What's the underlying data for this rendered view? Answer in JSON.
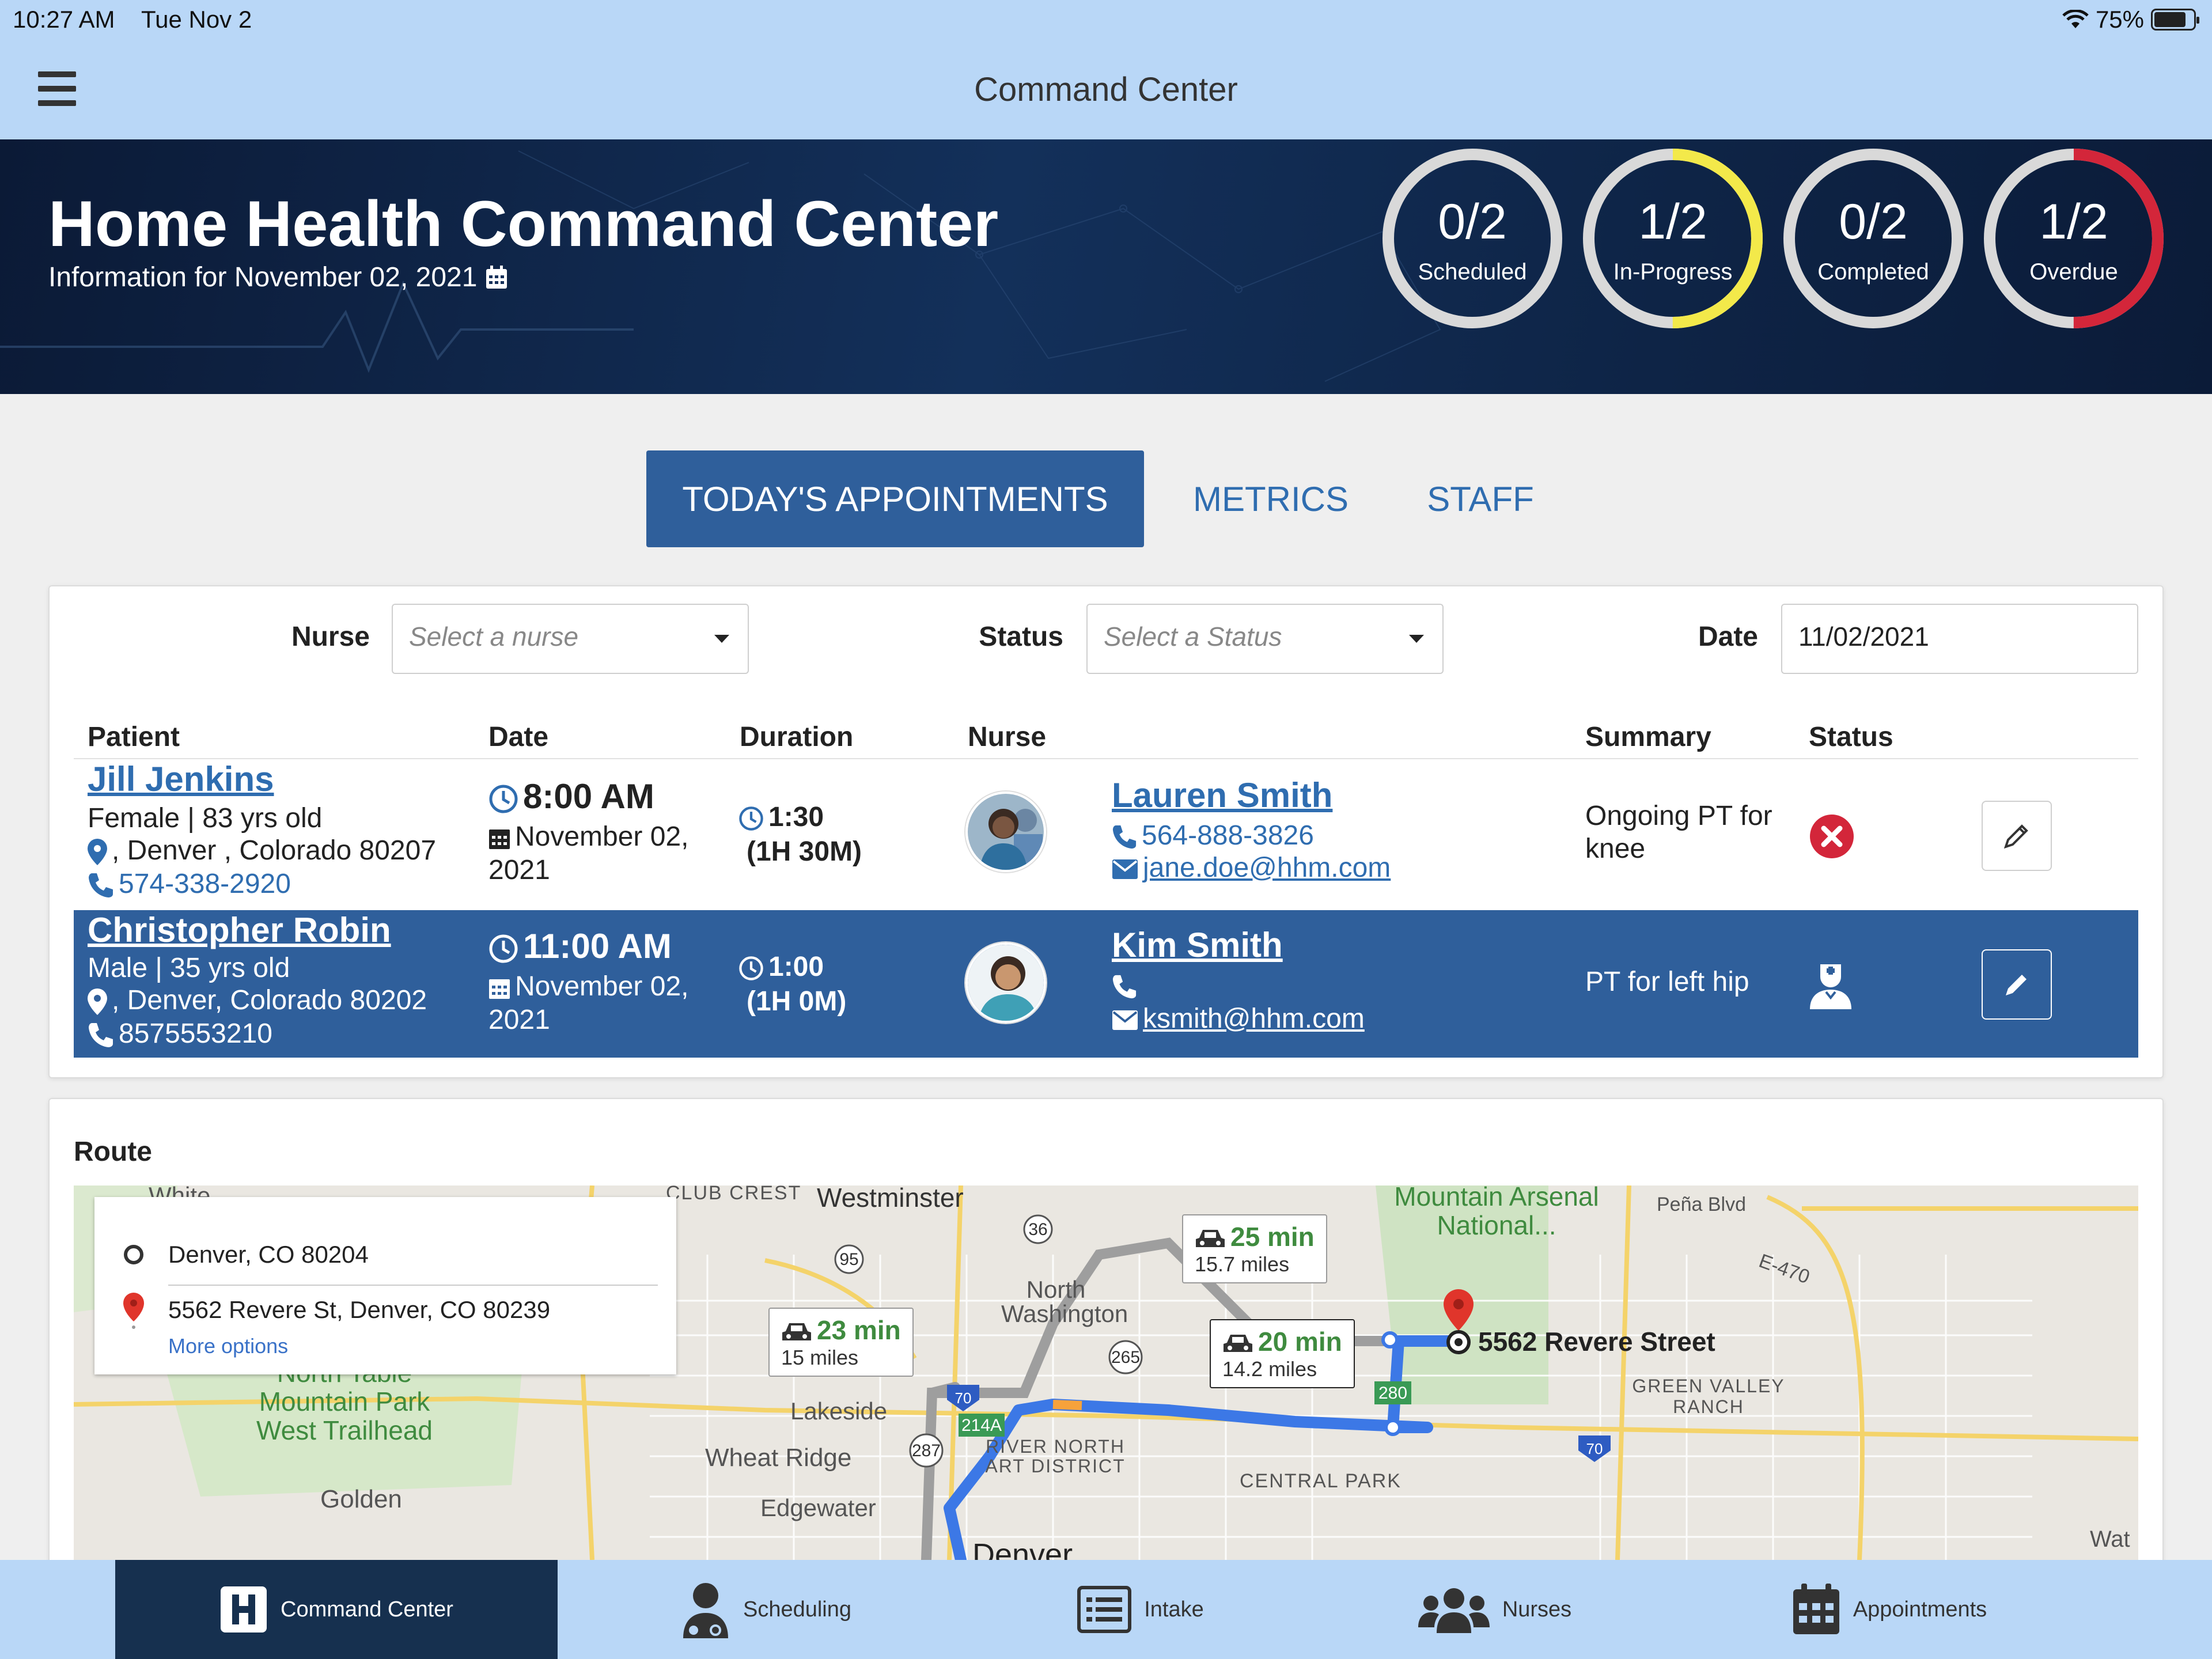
{
  "status_bar": {
    "time": "10:27 AM",
    "date": "Tue Nov 2",
    "battery": "75%"
  },
  "nav": {
    "title": "Command Center"
  },
  "hero": {
    "title": "Home Health Command Center",
    "subtitle": "Information for November 02, 2021",
    "stats": [
      {
        "value": "1/2",
        "label": "Overdue",
        "progress": 0.5,
        "color": "#d3263a"
      },
      {
        "value": "0/2",
        "label": "Completed",
        "progress": 0,
        "color": "#cccccc"
      },
      {
        "value": "1/2",
        "label": "In-Progress",
        "progress": 0.5,
        "color": "#f3e94a"
      },
      {
        "value": "0/2",
        "label": "Scheduled",
        "progress": 0,
        "color": "#cccccc"
      }
    ]
  },
  "tabs": [
    {
      "label": "TODAY'S APPOINTMENTS",
      "active": true
    },
    {
      "label": "METRICS",
      "active": false
    },
    {
      "label": "STAFF",
      "active": false
    }
  ],
  "filters": {
    "nurse_label": "Nurse",
    "nurse_placeholder": "Select a nurse",
    "status_label": "Status",
    "status_placeholder": "Select a Status",
    "date_label": "Date",
    "date_value": "11/02/2021"
  },
  "table": {
    "headers": [
      "Patient",
      "Date",
      "Duration",
      "Nurse",
      "Summary",
      "Status"
    ],
    "rows": [
      {
        "patient_name": "Jill Jenkins",
        "demographics": "Female | 83 yrs old",
        "address": ", Denver , Colorado 80207",
        "phone": "574-338-2920",
        "time": "8:00 AM",
        "date_line1": "November 02,",
        "date_line2": "2021",
        "duration": "1:30",
        "duration_long": "(1H 30M)",
        "nurse_name": "Lauren Smith",
        "nurse_phone": "564-888-3826",
        "nurse_email": "jane.doe@hhm.com",
        "summary": "Ongoing PT for knee",
        "status_icon": "overdue-x-icon"
      },
      {
        "patient_name": "Christopher Robin",
        "demographics": "Male | 35 yrs old",
        "address": ", Denver, Colorado 80202",
        "phone": "8575553210",
        "time": "11:00 AM",
        "date_line1": "November 02,",
        "date_line2": "2021",
        "duration": "1:00",
        "duration_long": "(1H 0M)",
        "nurse_name": "Kim Smith",
        "nurse_phone": "",
        "nurse_email": "ksmith@hhm.com",
        "summary": "PT for left hip",
        "status_icon": "nurse-in-progress-icon"
      }
    ]
  },
  "route": {
    "title": "Route",
    "origin": "Denver, CO 80204",
    "destination": "5562 Revere St, Denver, CO 80239",
    "more_options": "More options",
    "dest_marker_label": "5562 Revere Street",
    "options": [
      {
        "mins": "23 min",
        "miles": "15 miles"
      },
      {
        "mins": "25 min",
        "miles": "15.7 miles"
      },
      {
        "mins": "20 min",
        "miles": "14.2 miles"
      }
    ],
    "places": [
      {
        "name": "Westminster",
        "style": "normal"
      },
      {
        "name": "CLUB CREST",
        "style": "caps"
      },
      {
        "name": "North Washington",
        "style": "normal"
      },
      {
        "name": "Mountain Arsenal National...",
        "style": "green"
      },
      {
        "name": "Peña Blvd",
        "style": "normal"
      },
      {
        "name": "E-470",
        "style": "normal"
      },
      {
        "name": "GREEN VALLEY RANCH",
        "style": "caps"
      },
      {
        "name": "North Table Mountain Park West Trailhead",
        "style": "green"
      },
      {
        "name": "Lakeside",
        "style": "normal"
      },
      {
        "name": "Wheat Ridge",
        "style": "normal"
      },
      {
        "name": "Edgewater",
        "style": "normal"
      },
      {
        "name": "Golden",
        "style": "normal"
      },
      {
        "name": "RIVER NORTH ART DISTRICT",
        "style": "caps"
      },
      {
        "name": "CENTRAL PARK",
        "style": "caps"
      },
      {
        "name": "Denver",
        "style": "normal"
      },
      {
        "name": "White",
        "style": "normal"
      },
      {
        "name": "Wat",
        "style": "normal"
      }
    ],
    "road_shields": [
      "36",
      "95",
      "265",
      "70",
      "214A",
      "287",
      "280",
      "70",
      "E-470"
    ]
  },
  "bottom_nav": [
    {
      "label": "Command Center",
      "icon": "hospital-h-icon",
      "active": true
    },
    {
      "label": "Scheduling",
      "icon": "user-doctor-icon",
      "active": false
    },
    {
      "label": "Intake",
      "icon": "list-form-icon",
      "active": false
    },
    {
      "label": "Nurses",
      "icon": "users-group-icon",
      "active": false
    },
    {
      "label": "Appointments",
      "icon": "calendar-icon",
      "active": false
    }
  ]
}
